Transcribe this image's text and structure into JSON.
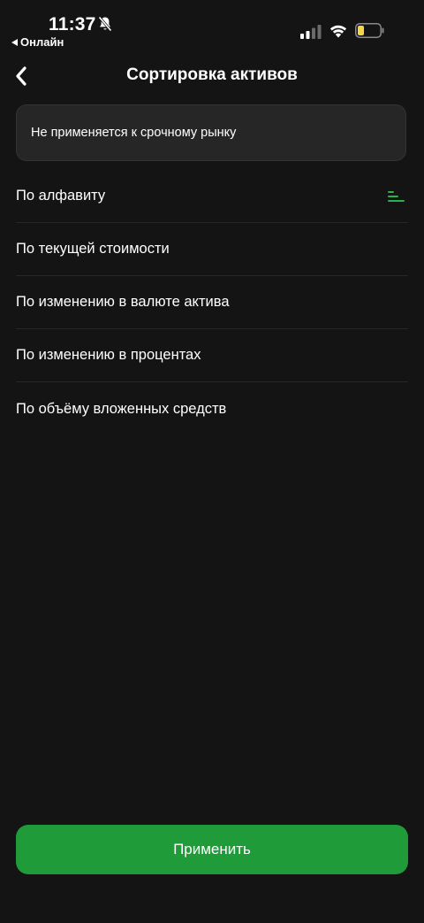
{
  "status_bar": {
    "time": "11:37",
    "back_app_label": "Онлайн",
    "icons": [
      "bell-off-icon",
      "cellular-signal-icon",
      "wifi-icon",
      "battery-icon"
    ],
    "battery_color": "#f5d547"
  },
  "header": {
    "back_icon": "chevron-left-icon",
    "title": "Сортировка активов"
  },
  "info_card": {
    "text": "Не применяется к срочному рынку"
  },
  "sort_options": [
    {
      "label": "По алфавиту",
      "selected": true
    },
    {
      "label": "По текущей стоимости",
      "selected": false
    },
    {
      "label": "По изменению в валюте актива",
      "selected": false
    },
    {
      "label": "По изменению в процентах",
      "selected": false
    },
    {
      "label": "По объёму вложенных средств",
      "selected": false
    }
  ],
  "selected_icon": "sort-ascending-icon",
  "apply_button": {
    "label": "Применить"
  },
  "colors": {
    "background": "#141414",
    "card": "#262626",
    "accent": "#1f9b3a",
    "selected_icon": "#2bb24c"
  }
}
